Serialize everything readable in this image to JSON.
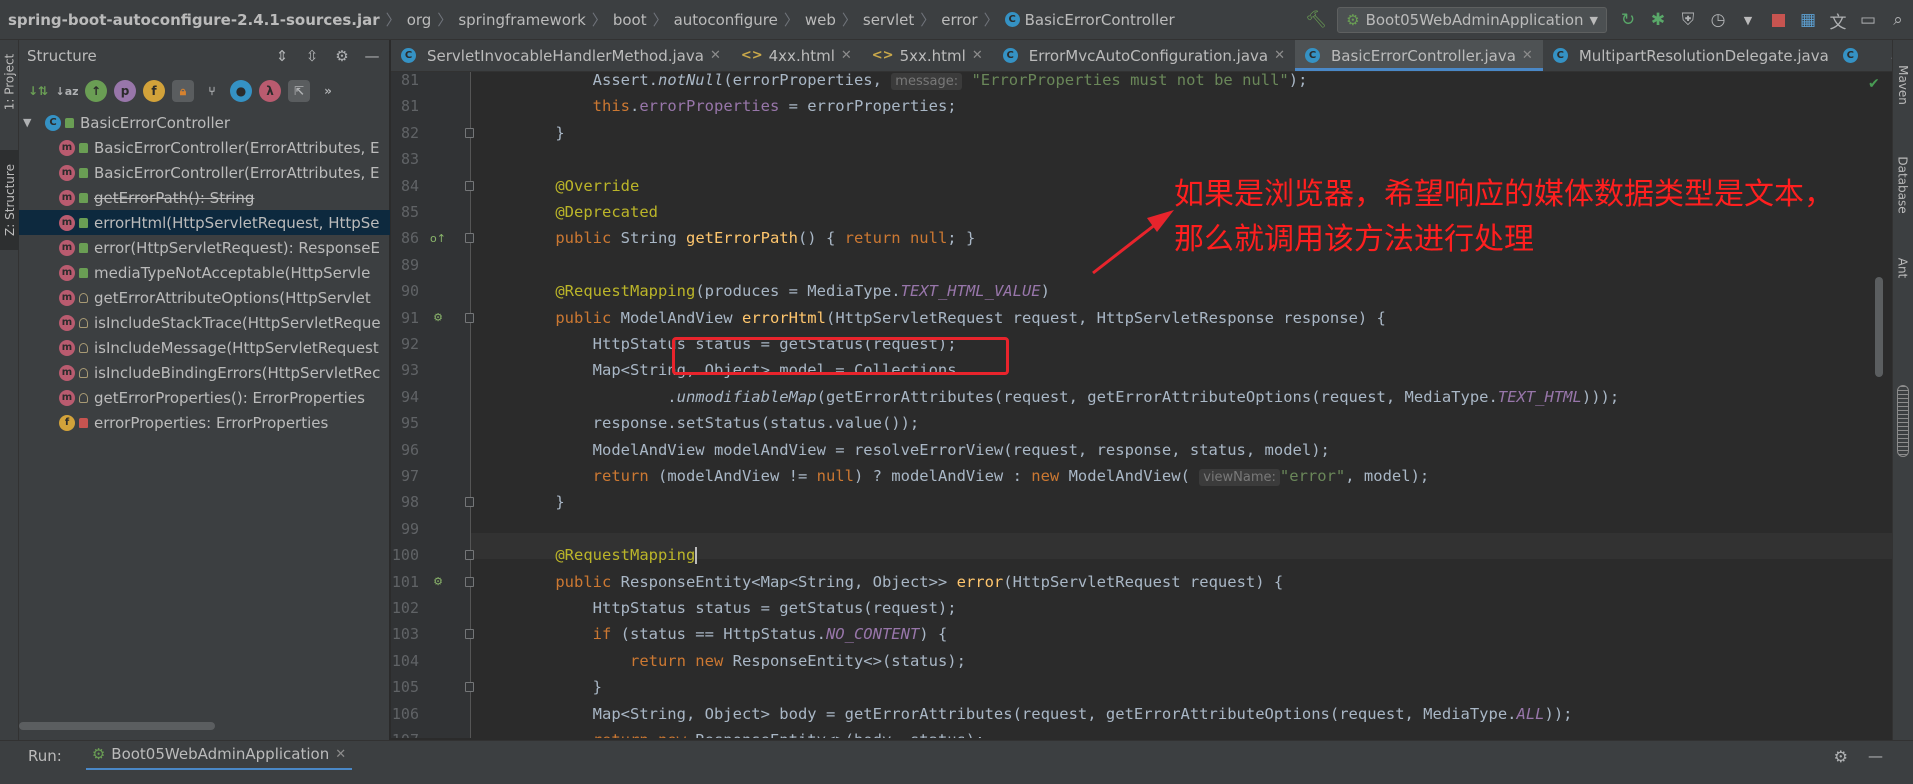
{
  "breadcrumb": {
    "items": [
      "spring-boot-autoconfigure-2.4.1-sources.jar",
      "org",
      "springframework",
      "boot",
      "autoconfigure",
      "web",
      "servlet",
      "error",
      "BasicErrorController"
    ]
  },
  "run_config": {
    "name": "Boot05WebAdminApplication"
  },
  "tool_windows": {
    "left": [
      "1: Project",
      "Z: Structure"
    ],
    "right": [
      "Maven",
      "Database",
      "Ant"
    ]
  },
  "structure": {
    "title": "Structure",
    "toolbar_icons": [
      "sort-visibility-icon",
      "sort-alpha-icon",
      "inherited-icon",
      "properties-icon",
      "fields-icon",
      "non-public-icon",
      "lambdas-icon",
      "anonymous-classes-icon",
      "lambda-icon",
      "autoscroll-from-source-icon"
    ],
    "root": "BasicErrorController",
    "items": [
      {
        "kind": "method",
        "visibility": "public",
        "label": "BasicErrorController(ErrorAttributes, E",
        "deprecated": false
      },
      {
        "kind": "method",
        "visibility": "public",
        "label": "BasicErrorController(ErrorAttributes, E",
        "deprecated": false
      },
      {
        "kind": "method",
        "visibility": "public",
        "label": "getErrorPath(): String",
        "deprecated": true
      },
      {
        "kind": "method",
        "visibility": "public",
        "label": "errorHtml(HttpServletRequest, HttpSe",
        "deprecated": false,
        "selected": true
      },
      {
        "kind": "method",
        "visibility": "public",
        "label": "error(HttpServletRequest): ResponseE",
        "deprecated": false
      },
      {
        "kind": "method",
        "visibility": "public",
        "label": "mediaTypeNotAcceptable(HttpServle",
        "deprecated": false
      },
      {
        "kind": "method",
        "visibility": "protected",
        "label": "getErrorAttributeOptions(HttpServlet",
        "deprecated": false
      },
      {
        "kind": "method",
        "visibility": "protected",
        "label": "isIncludeStackTrace(HttpServletReque",
        "deprecated": false
      },
      {
        "kind": "method",
        "visibility": "protected",
        "label": "isIncludeMessage(HttpServletRequest",
        "deprecated": false
      },
      {
        "kind": "method",
        "visibility": "protected",
        "label": "isIncludeBindingErrors(HttpServletRec",
        "deprecated": false
      },
      {
        "kind": "method",
        "visibility": "protected",
        "label": "getErrorProperties(): ErrorProperties",
        "deprecated": false
      },
      {
        "kind": "field",
        "visibility": "private",
        "label": "errorProperties: ErrorProperties",
        "deprecated": false
      }
    ]
  },
  "tabs": [
    {
      "label": "ServletInvocableHandlerMethod.java",
      "icon": "class-icon",
      "active": false
    },
    {
      "label": "4xx.html",
      "icon": "html-icon",
      "active": false
    },
    {
      "label": "5xx.html",
      "icon": "html-icon",
      "active": false
    },
    {
      "label": "ErrorMvcAutoConfiguration.java",
      "icon": "class-icon",
      "active": false
    },
    {
      "label": "BasicErrorController.java",
      "icon": "class-icon",
      "active": true
    },
    {
      "label": "MultipartResolutionDelegate.java",
      "icon": "class-icon",
      "active": false
    }
  ],
  "editor": {
    "current_line": "100",
    "lines": [
      {
        "num": "81",
        "tokens": [
          [
            "",
            "        Assert."
          ],
          [
            "static",
            "notNull"
          ],
          [
            "",
            "(errorProperties, "
          ],
          [
            "hint",
            "message:"
          ],
          [
            "",
            " "
          ],
          [
            "str",
            "\"ErrorProperties must not be null\""
          ],
          [
            "",
            ");"
          ]
        ]
      },
      {
        "num": "81",
        "tokens": [
          [
            "",
            "        "
          ],
          [
            "kw",
            "this"
          ],
          [
            "",
            "."
          ],
          [
            "fld",
            "errorProperties"
          ],
          [
            "",
            " = errorProperties;"
          ]
        ]
      },
      {
        "num": "82",
        "tokens": [
          [
            "",
            "    }"
          ]
        ]
      },
      {
        "num": "83",
        "tokens": []
      },
      {
        "num": "84",
        "tokens": [
          [
            "",
            "    "
          ],
          [
            "ann",
            "@Override"
          ]
        ]
      },
      {
        "num": "85",
        "tokens": [
          [
            "",
            "    "
          ],
          [
            "ann",
            "@Deprecated"
          ]
        ]
      },
      {
        "num": "86",
        "tokens": [
          [
            "",
            "    "
          ],
          [
            "kw",
            "public "
          ],
          [
            "",
            "String "
          ],
          [
            "fn",
            "getErrorPath"
          ],
          [
            "",
            "() { "
          ],
          [
            "kw",
            "return null"
          ],
          [
            "",
            "; }"
          ]
        ]
      },
      {
        "num": "89",
        "tokens": []
      },
      {
        "num": "90",
        "tokens": [
          [
            "",
            "    "
          ],
          [
            "ann",
            "@RequestMapping"
          ],
          [
            "",
            "(produces = MediaType."
          ],
          [
            "const",
            "TEXT_HTML_VALUE"
          ],
          [
            "",
            ")"
          ]
        ]
      },
      {
        "num": "91",
        "tokens": [
          [
            "",
            "    "
          ],
          [
            "kw",
            "public "
          ],
          [
            "",
            "ModelAndView "
          ],
          [
            "fn",
            "errorHtml"
          ],
          [
            "",
            "(HttpServletRequest request, HttpServletResponse response) {"
          ]
        ]
      },
      {
        "num": "92",
        "tokens": [
          [
            "",
            "        HttpStatus status = getStatus(request);"
          ]
        ]
      },
      {
        "num": "93",
        "tokens": [
          [
            "",
            "        Map<String, Object> model = Collections"
          ]
        ]
      },
      {
        "num": "94",
        "tokens": [
          [
            "",
            "                ."
          ],
          [
            "static",
            "unmodifiableMap"
          ],
          [
            "",
            "(getErrorAttributes(request, getErrorAttributeOptions(request, MediaType."
          ],
          [
            "const",
            "TEXT_HTML"
          ],
          [
            "",
            ")));"
          ]
        ]
      },
      {
        "num": "95",
        "tokens": [
          [
            "",
            "        response.setStatus(status.value());"
          ]
        ]
      },
      {
        "num": "96",
        "tokens": [
          [
            "",
            "        ModelAndView modelAndView = resolveErrorView(request, response, status, model);"
          ]
        ]
      },
      {
        "num": "97",
        "tokens": [
          [
            "",
            "        "
          ],
          [
            "kw",
            "return "
          ],
          [
            "",
            "(modelAndView != "
          ],
          [
            "kw",
            "null"
          ],
          [
            "",
            ") ? modelAndView : "
          ],
          [
            "kw",
            "new "
          ],
          [
            "",
            "ModelAndView( "
          ],
          [
            "hint",
            "viewName:"
          ],
          [
            "str",
            "\"error\""
          ],
          [
            "",
            ", model);"
          ]
        ]
      },
      {
        "num": "98",
        "tokens": [
          [
            "",
            "    }"
          ]
        ]
      },
      {
        "num": "99",
        "tokens": []
      },
      {
        "num": "100",
        "tokens": [
          [
            "",
            "    "
          ],
          [
            "ann",
            "@RequestMapping"
          ],
          [
            "caret",
            ""
          ]
        ]
      },
      {
        "num": "101",
        "tokens": [
          [
            "",
            "    "
          ],
          [
            "kw",
            "public "
          ],
          [
            "",
            "ResponseEntity<Map<String, Object>> "
          ],
          [
            "fn",
            "error"
          ],
          [
            "",
            "(HttpServletRequest request) {"
          ]
        ]
      },
      {
        "num": "102",
        "tokens": [
          [
            "",
            "        HttpStatus status = getStatus(request);"
          ]
        ]
      },
      {
        "num": "103",
        "tokens": [
          [
            "",
            "        "
          ],
          [
            "kw",
            "if "
          ],
          [
            "",
            "(status == HttpStatus."
          ],
          [
            "const",
            "NO_CONTENT"
          ],
          [
            "",
            ") {"
          ]
        ]
      },
      {
        "num": "104",
        "tokens": [
          [
            "",
            "            "
          ],
          [
            "kw",
            "return new "
          ],
          [
            "",
            "ResponseEntity<>(status);"
          ]
        ]
      },
      {
        "num": "105",
        "tokens": [
          [
            "",
            "        }"
          ]
        ]
      },
      {
        "num": "106",
        "tokens": [
          [
            "",
            "        Map<String, Object> body = getErrorAttributes(request, getErrorAttributeOptions(request, MediaType."
          ],
          [
            "const",
            "ALL"
          ],
          [
            "",
            "));"
          ]
        ]
      },
      {
        "num": "107",
        "tokens": [
          [
            "",
            "        "
          ],
          [
            "kw",
            "return new "
          ],
          [
            "",
            "ResponseEntity<>(body, status);"
          ]
        ]
      }
    ]
  },
  "annotation": {
    "line1": "如果是浏览器，希望响应的媒体数据类型是文本，",
    "line2": "那么就调用该方法进行处理",
    "color": "#ff1f1f"
  },
  "runbar": {
    "label": "Run:",
    "tab": "Boot05WebAdminApplication"
  },
  "colors": {
    "keyword": "#cc7832",
    "annotation": "#bbb529",
    "method": "#ffc66d",
    "field": "#9876aa",
    "string": "#6a8759",
    "accent": "#4a88c7",
    "highlight_box": "#e8242c"
  }
}
